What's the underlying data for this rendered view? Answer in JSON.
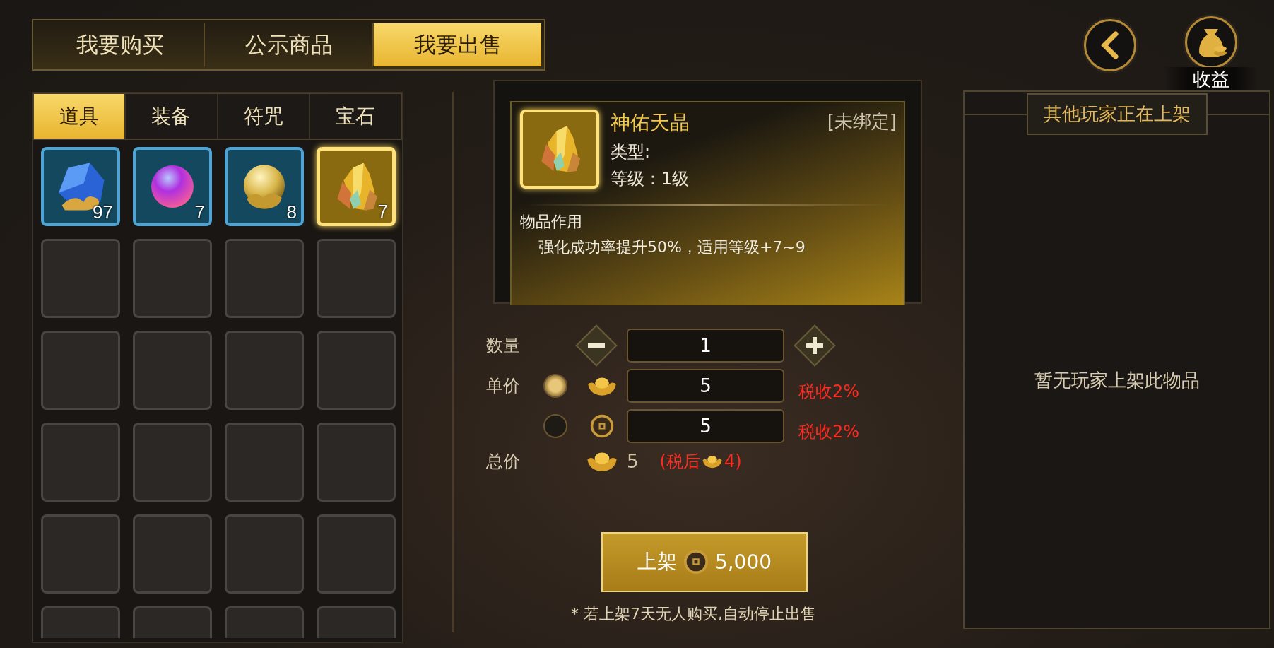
{
  "top_tabs": [
    {
      "label": "我要购买",
      "selected": false
    },
    {
      "label": "公示商品",
      "selected": false
    },
    {
      "label": "我要出售",
      "selected": true
    }
  ],
  "income_label": "收益",
  "categories": [
    {
      "label": "道具",
      "selected": true
    },
    {
      "label": "装备",
      "selected": false
    },
    {
      "label": "符咒",
      "selected": false
    },
    {
      "label": "宝石",
      "selected": false
    }
  ],
  "items": [
    {
      "kind": "sapphire",
      "count": "97",
      "selected": false
    },
    {
      "kind": "orb",
      "count": "7",
      "selected": false
    },
    {
      "kind": "pearl",
      "count": "8",
      "selected": false
    },
    {
      "kind": "crystal",
      "count": "7",
      "selected": true
    },
    {
      "kind": "empty",
      "selected": false
    },
    {
      "kind": "empty",
      "selected": false
    },
    {
      "kind": "empty",
      "selected": false
    },
    {
      "kind": "empty",
      "selected": false
    },
    {
      "kind": "empty",
      "selected": false
    },
    {
      "kind": "empty",
      "selected": false
    },
    {
      "kind": "empty",
      "selected": false
    },
    {
      "kind": "empty",
      "selected": false
    },
    {
      "kind": "empty",
      "selected": false
    },
    {
      "kind": "empty",
      "selected": false
    },
    {
      "kind": "empty",
      "selected": false
    },
    {
      "kind": "empty",
      "selected": false
    },
    {
      "kind": "empty",
      "selected": false
    },
    {
      "kind": "empty",
      "selected": false
    },
    {
      "kind": "empty",
      "selected": false
    },
    {
      "kind": "empty",
      "selected": false
    },
    {
      "kind": "empty",
      "selected": false
    },
    {
      "kind": "empty",
      "selected": false
    },
    {
      "kind": "empty",
      "selected": false
    },
    {
      "kind": "empty",
      "selected": false
    }
  ],
  "detail": {
    "kind": "crystal",
    "name": "神佑天晶",
    "bind_status": "[未绑定]",
    "type_label": "类型:",
    "level_label": "等级：1级",
    "effect_title": "物品作用",
    "effect_text": "强化成功率提升50%，适用等级+7~9"
  },
  "quantity": {
    "label": "数量",
    "value": "1"
  },
  "unit_price": {
    "label": "单价",
    "options": [
      {
        "kind": "ingot",
        "value": "5",
        "tax": "税收2%",
        "selected": true
      },
      {
        "kind": "coin",
        "value": "5",
        "tax": "税收2%",
        "selected": false
      }
    ]
  },
  "total": {
    "label": "总价",
    "kind": "ingot",
    "value": "5",
    "after_tax_prefix": "(税后",
    "after_tax_value": "4)"
  },
  "list_button": {
    "label": "上架",
    "kind": "coin",
    "cost": "5,000"
  },
  "notice": "* 若上架7天无人购买,自动停止出售",
  "other_listings": {
    "title": "其他玩家正在上架",
    "empty_text": "暂无玩家上架此物品"
  }
}
